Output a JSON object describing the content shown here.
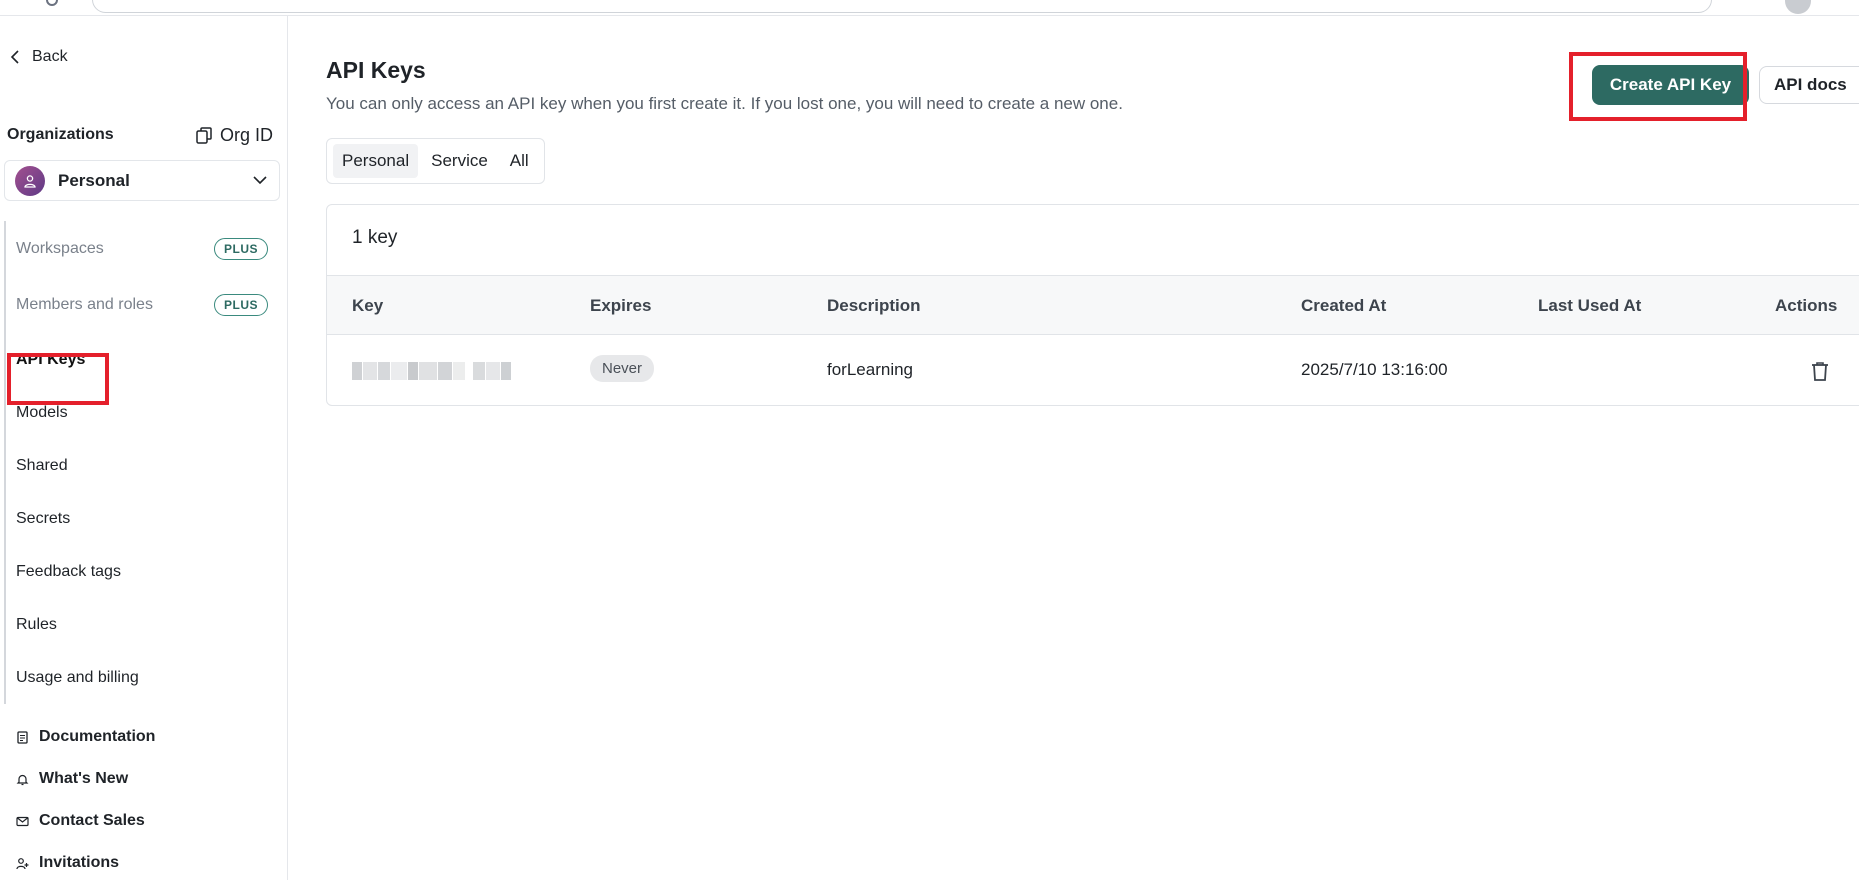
{
  "sidebar": {
    "back_label": "Back",
    "org_label": "Organizations",
    "org_id_label": "Org ID",
    "org_selected": "Personal",
    "nav": [
      {
        "label": "Workspaces",
        "badge": "PLUS"
      },
      {
        "label": "Members and roles",
        "badge": "PLUS"
      },
      {
        "label": "API Keys"
      },
      {
        "label": "Models"
      },
      {
        "label": "Shared"
      },
      {
        "label": "Secrets"
      },
      {
        "label": "Feedback tags"
      },
      {
        "label": "Rules"
      },
      {
        "label": "Usage and billing"
      }
    ],
    "bottom_links": [
      {
        "label": "Documentation",
        "icon": "document-icon"
      },
      {
        "label": "What's New",
        "icon": "bell-icon"
      },
      {
        "label": "Contact Sales",
        "icon": "mail-icon"
      },
      {
        "label": "Invitations",
        "icon": "user-plus-icon"
      }
    ]
  },
  "main": {
    "title": "API Keys",
    "subtitle": "You can only access an API key when you first create it. If you lost one, you will need to create a new one.",
    "create_button": "Create API Key",
    "docs_button": "API docs",
    "tabs": [
      "Personal",
      "Service",
      "All"
    ],
    "selected_tab": "Personal",
    "key_count": "1 key",
    "columns": [
      "Key",
      "Expires",
      "Description",
      "Created At",
      "Last Used At",
      "Actions"
    ],
    "rows": [
      {
        "key": "",
        "expires": "Never",
        "description": "forLearning",
        "created_at": "2025/7/10 13:16:00",
        "last_used_at": ""
      }
    ]
  },
  "colors": {
    "accent": "#2d6a62",
    "highlight": "#e4202b"
  }
}
